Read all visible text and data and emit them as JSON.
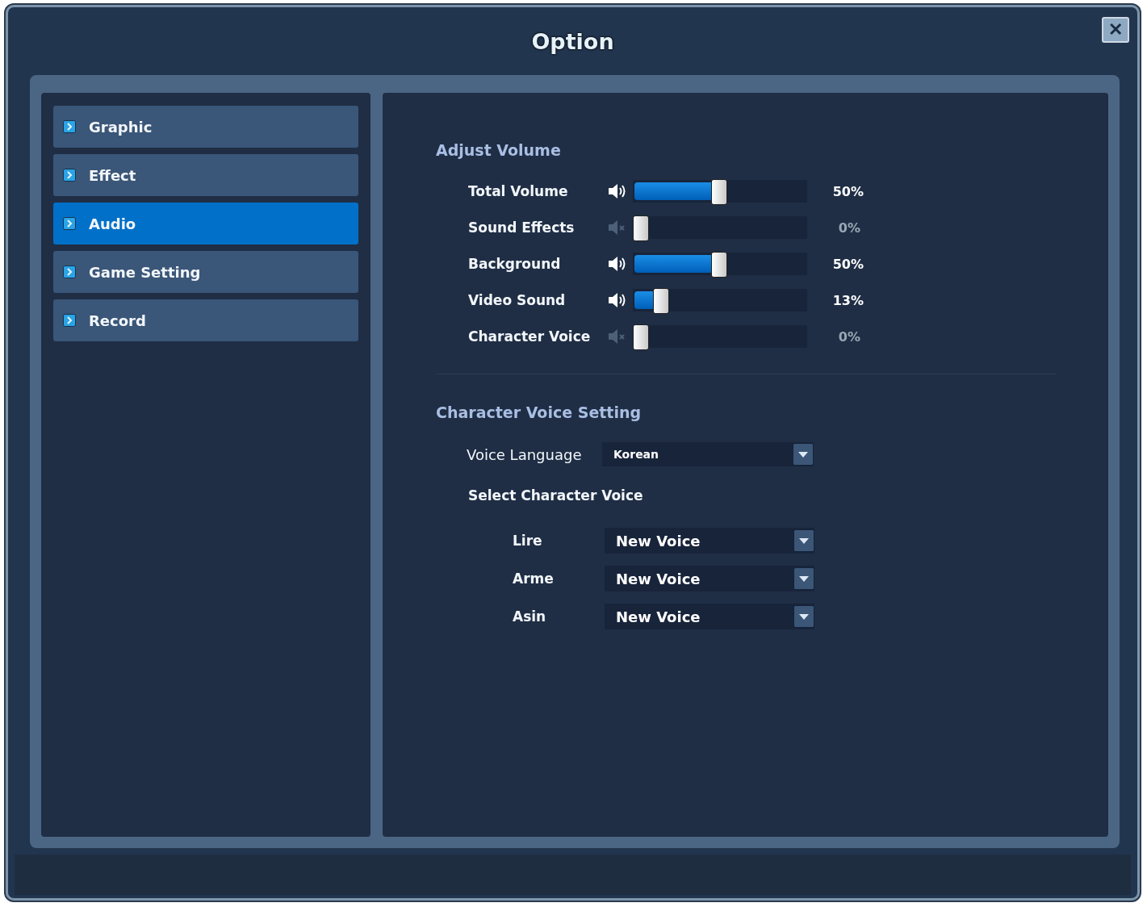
{
  "window": {
    "title": "Option",
    "close_glyph": "✕"
  },
  "sidebar": {
    "items": [
      {
        "label": "Graphic",
        "selected": false
      },
      {
        "label": "Effect",
        "selected": false
      },
      {
        "label": "Audio",
        "selected": true
      },
      {
        "label": "Game Setting",
        "selected": false
      },
      {
        "label": "Record",
        "selected": false
      }
    ]
  },
  "adjust_volume": {
    "heading": "Adjust Volume",
    "channels": [
      {
        "name": "Total Volume",
        "muted": false,
        "level": 0.5,
        "reading": "50%"
      },
      {
        "name": "Sound Effects",
        "muted": true,
        "level": 0,
        "reading": "0%"
      },
      {
        "name": "Background",
        "muted": false,
        "level": 0.5,
        "reading": "50%"
      },
      {
        "name": "Video Sound",
        "muted": false,
        "level": 0.13,
        "reading": "13%"
      },
      {
        "name": "Character Voice",
        "muted": true,
        "level": 0,
        "reading": "0%"
      }
    ]
  },
  "character_voice_setting": {
    "heading": "Character Voice Setting",
    "voice_language": {
      "label": "Voice Language",
      "value": "Korean"
    },
    "select_heading": "Select Character Voice",
    "characters": [
      {
        "name": "Lire",
        "value": "New Voice"
      },
      {
        "name": "Arme",
        "value": "New Voice"
      },
      {
        "name": "Asin",
        "value": "New Voice"
      }
    ]
  }
}
